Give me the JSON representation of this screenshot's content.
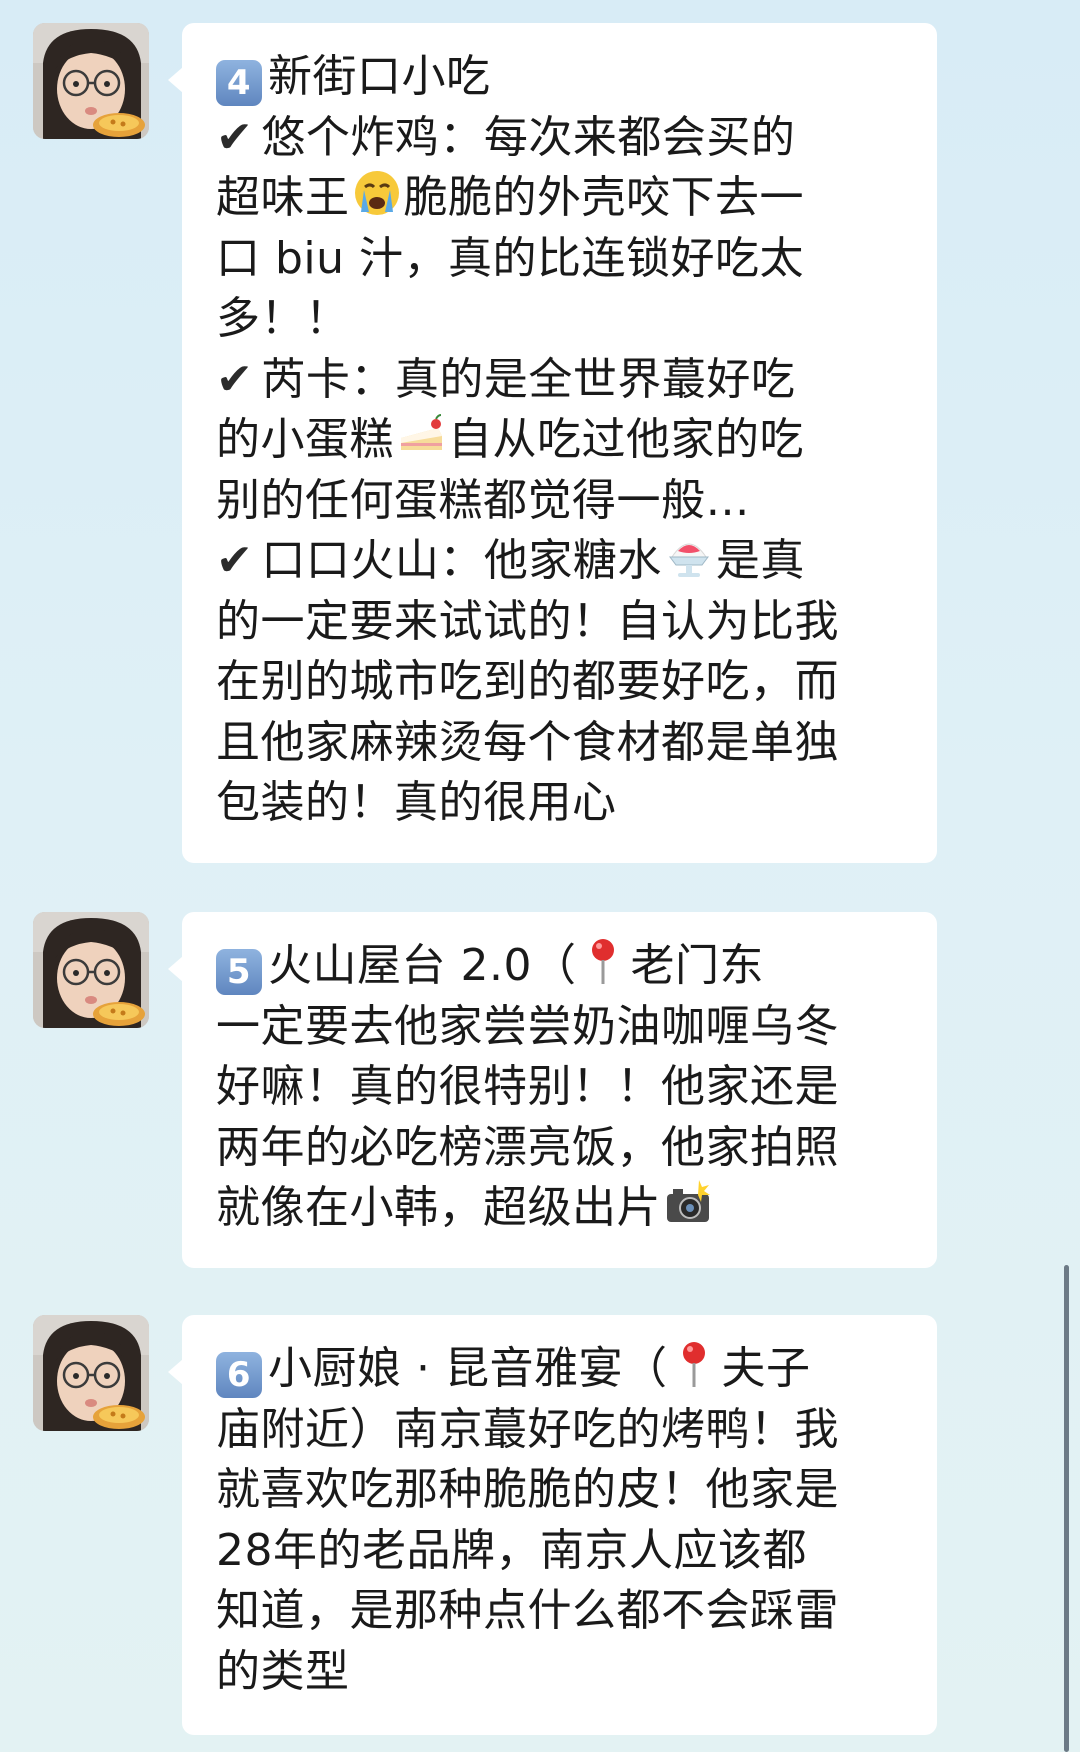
{
  "messages": [
    {
      "lines": [
        {
          "badge": "4",
          "text": "新街口小吃"
        },
        {
          "check": "✔",
          "text": "悠个炸鸡：每次来都会买的"
        },
        {
          "text_before": "超味王",
          "emoji": "crying-face-emoji",
          "text_after": "脆脆的外壳咬下去一"
        },
        {
          "text": "口 biu 汁，真的比连锁好吃太"
        },
        {
          "text": "多！！"
        },
        {
          "check": "✔",
          "text": "芮卡：真的是全世界蕞好吃"
        },
        {
          "text_before": "的小蛋糕",
          "emoji": "cake-emoji",
          "text_after": "自从吃过他家的吃"
        },
        {
          "text": "别的任何蛋糕都觉得一般…"
        },
        {
          "check": "✔",
          "text_before": "口口火山：他家糖水",
          "emoji": "shaved-ice-emoji",
          "text_after": "是真"
        },
        {
          "text": "的一定要来试试的！自认为比我"
        },
        {
          "text": "在别的城市吃到的都要好吃，而"
        },
        {
          "text": "且他家麻辣烫每个食材都是单独"
        },
        {
          "text": "包装的！真的很用心"
        }
      ]
    },
    {
      "lines": [
        {
          "badge": "5",
          "text_before": "火山屋台 2.0（",
          "emoji": "pin-emoji",
          "text_after": "老门东"
        },
        {
          "text": "一定要去他家尝尝奶油咖喱乌冬"
        },
        {
          "text": "好嘛！真的很特别！！他家还是"
        },
        {
          "text": "两年的必吃榜漂亮饭，他家拍照"
        },
        {
          "text_before": "就像在小韩，超级出片",
          "emoji": "camera-flash-emoji",
          "text_after": ""
        }
      ]
    },
    {
      "lines": [
        {
          "badge": "6",
          "text_before": "小厨娘 · 昆音雅宴（",
          "emoji": "pin-emoji",
          "text_after": "夫子"
        },
        {
          "text": "庙附近）南京蕞好吃的烤鸭！我"
        },
        {
          "text": "就喜欢吃那种脆脆的皮！他家是"
        },
        {
          "text": "28年的老品牌，南京人应该都"
        },
        {
          "text": "知道，是那种点什么都不会踩雷"
        },
        {
          "text": "的类型"
        }
      ]
    }
  ]
}
